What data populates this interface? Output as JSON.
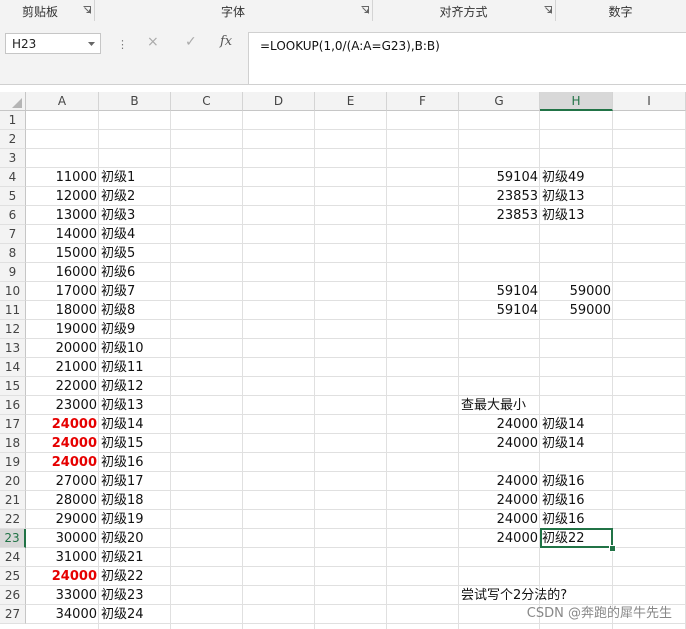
{
  "ribbon": {
    "groups": [
      "剪贴板",
      "字体",
      "对齐方式",
      "数字"
    ]
  },
  "name_box": {
    "value": "H23"
  },
  "formula_bar": {
    "cancel_icon": "×",
    "enter_icon": "✓",
    "fx_label": "fx",
    "formula": "=LOOKUP(1,0/(A:A=G23),B:B)"
  },
  "columns": [
    "A",
    "B",
    "C",
    "D",
    "E",
    "F",
    "G",
    "H",
    "I"
  ],
  "selected_column": "H",
  "rows": [
    "1",
    "2",
    "3",
    "4",
    "5",
    "6",
    "7",
    "8",
    "9",
    "10",
    "11",
    "12",
    "13",
    "14",
    "15",
    "16",
    "17",
    "18",
    "19",
    "20",
    "21",
    "22",
    "23",
    "24",
    "25",
    "26",
    "27"
  ],
  "selected_row": "23",
  "cells": [
    {
      "ref": "A4",
      "text": "11000",
      "type": "num"
    },
    {
      "ref": "B4",
      "text": "初级1",
      "type": "txt"
    },
    {
      "ref": "A5",
      "text": "12000",
      "type": "num"
    },
    {
      "ref": "B5",
      "text": "初级2",
      "type": "txt"
    },
    {
      "ref": "A6",
      "text": "13000",
      "type": "num"
    },
    {
      "ref": "B6",
      "text": "初级3",
      "type": "txt"
    },
    {
      "ref": "A7",
      "text": "14000",
      "type": "num"
    },
    {
      "ref": "B7",
      "text": "初级4",
      "type": "txt"
    },
    {
      "ref": "A8",
      "text": "15000",
      "type": "num"
    },
    {
      "ref": "B8",
      "text": "初级5",
      "type": "txt"
    },
    {
      "ref": "A9",
      "text": "16000",
      "type": "num"
    },
    {
      "ref": "B9",
      "text": "初级6",
      "type": "txt"
    },
    {
      "ref": "A10",
      "text": "17000",
      "type": "num"
    },
    {
      "ref": "B10",
      "text": "初级7",
      "type": "txt"
    },
    {
      "ref": "A11",
      "text": "18000",
      "type": "num"
    },
    {
      "ref": "B11",
      "text": "初级8",
      "type": "txt"
    },
    {
      "ref": "A12",
      "text": "19000",
      "type": "num"
    },
    {
      "ref": "B12",
      "text": "初级9",
      "type": "txt"
    },
    {
      "ref": "A13",
      "text": "20000",
      "type": "num"
    },
    {
      "ref": "B13",
      "text": "初级10",
      "type": "txt"
    },
    {
      "ref": "A14",
      "text": "21000",
      "type": "num"
    },
    {
      "ref": "B14",
      "text": "初级11",
      "type": "txt"
    },
    {
      "ref": "A15",
      "text": "22000",
      "type": "num"
    },
    {
      "ref": "B15",
      "text": "初级12",
      "type": "txt"
    },
    {
      "ref": "A16",
      "text": "23000",
      "type": "num"
    },
    {
      "ref": "B16",
      "text": "初级13",
      "type": "txt"
    },
    {
      "ref": "A17",
      "text": "24000",
      "type": "num",
      "highlight": true
    },
    {
      "ref": "B17",
      "text": "初级14",
      "type": "txt"
    },
    {
      "ref": "A18",
      "text": "24000",
      "type": "num",
      "highlight": true
    },
    {
      "ref": "B18",
      "text": "初级15",
      "type": "txt"
    },
    {
      "ref": "A19",
      "text": "24000",
      "type": "num",
      "highlight": true
    },
    {
      "ref": "B19",
      "text": "初级16",
      "type": "txt"
    },
    {
      "ref": "A20",
      "text": "27000",
      "type": "num"
    },
    {
      "ref": "B20",
      "text": "初级17",
      "type": "txt"
    },
    {
      "ref": "A21",
      "text": "28000",
      "type": "num"
    },
    {
      "ref": "B21",
      "text": "初级18",
      "type": "txt"
    },
    {
      "ref": "A22",
      "text": "29000",
      "type": "num"
    },
    {
      "ref": "B22",
      "text": "初级19",
      "type": "txt"
    },
    {
      "ref": "A23",
      "text": "30000",
      "type": "num"
    },
    {
      "ref": "B23",
      "text": "初级20",
      "type": "txt"
    },
    {
      "ref": "A24",
      "text": "31000",
      "type": "num"
    },
    {
      "ref": "B24",
      "text": "初级21",
      "type": "txt"
    },
    {
      "ref": "A25",
      "text": "24000",
      "type": "num",
      "highlight": true
    },
    {
      "ref": "B25",
      "text": "初级22",
      "type": "txt"
    },
    {
      "ref": "A26",
      "text": "33000",
      "type": "num"
    },
    {
      "ref": "B26",
      "text": "初级23",
      "type": "txt"
    },
    {
      "ref": "A27",
      "text": "34000",
      "type": "num"
    },
    {
      "ref": "B27",
      "text": "初级24",
      "type": "txt"
    },
    {
      "ref": "G4",
      "text": "59104",
      "type": "num"
    },
    {
      "ref": "H4",
      "text": "初级49",
      "type": "txt"
    },
    {
      "ref": "G5",
      "text": "23853",
      "type": "num"
    },
    {
      "ref": "H5",
      "text": "初级13",
      "type": "txt"
    },
    {
      "ref": "G6",
      "text": "23853",
      "type": "num"
    },
    {
      "ref": "H6",
      "text": "初级13",
      "type": "txt"
    },
    {
      "ref": "G10",
      "text": "59104",
      "type": "num"
    },
    {
      "ref": "H10",
      "text": "59000",
      "type": "num"
    },
    {
      "ref": "G11",
      "text": "59104",
      "type": "num"
    },
    {
      "ref": "H11",
      "text": "59000",
      "type": "num"
    },
    {
      "ref": "G16",
      "text": "查最大最小",
      "type": "txt"
    },
    {
      "ref": "G17",
      "text": "24000",
      "type": "num"
    },
    {
      "ref": "H17",
      "text": "初级14",
      "type": "txt"
    },
    {
      "ref": "G18",
      "text": "24000",
      "type": "num"
    },
    {
      "ref": "H18",
      "text": "初级14",
      "type": "txt"
    },
    {
      "ref": "G20",
      "text": "24000",
      "type": "num"
    },
    {
      "ref": "H20",
      "text": "初级16",
      "type": "txt"
    },
    {
      "ref": "G21",
      "text": "24000",
      "type": "num"
    },
    {
      "ref": "H21",
      "text": "初级16",
      "type": "txt"
    },
    {
      "ref": "G22",
      "text": "24000",
      "type": "num"
    },
    {
      "ref": "H22",
      "text": "初级16",
      "type": "txt"
    },
    {
      "ref": "G23",
      "text": "24000",
      "type": "num"
    },
    {
      "ref": "H23",
      "text": "初级22",
      "type": "txt"
    },
    {
      "ref": "G26",
      "text": "尝试写个2分法的?",
      "type": "txt"
    }
  ],
  "highlight_color": "#e60000",
  "accent_color": "#217346",
  "watermark": "CSDN @奔跑的犀牛先生"
}
